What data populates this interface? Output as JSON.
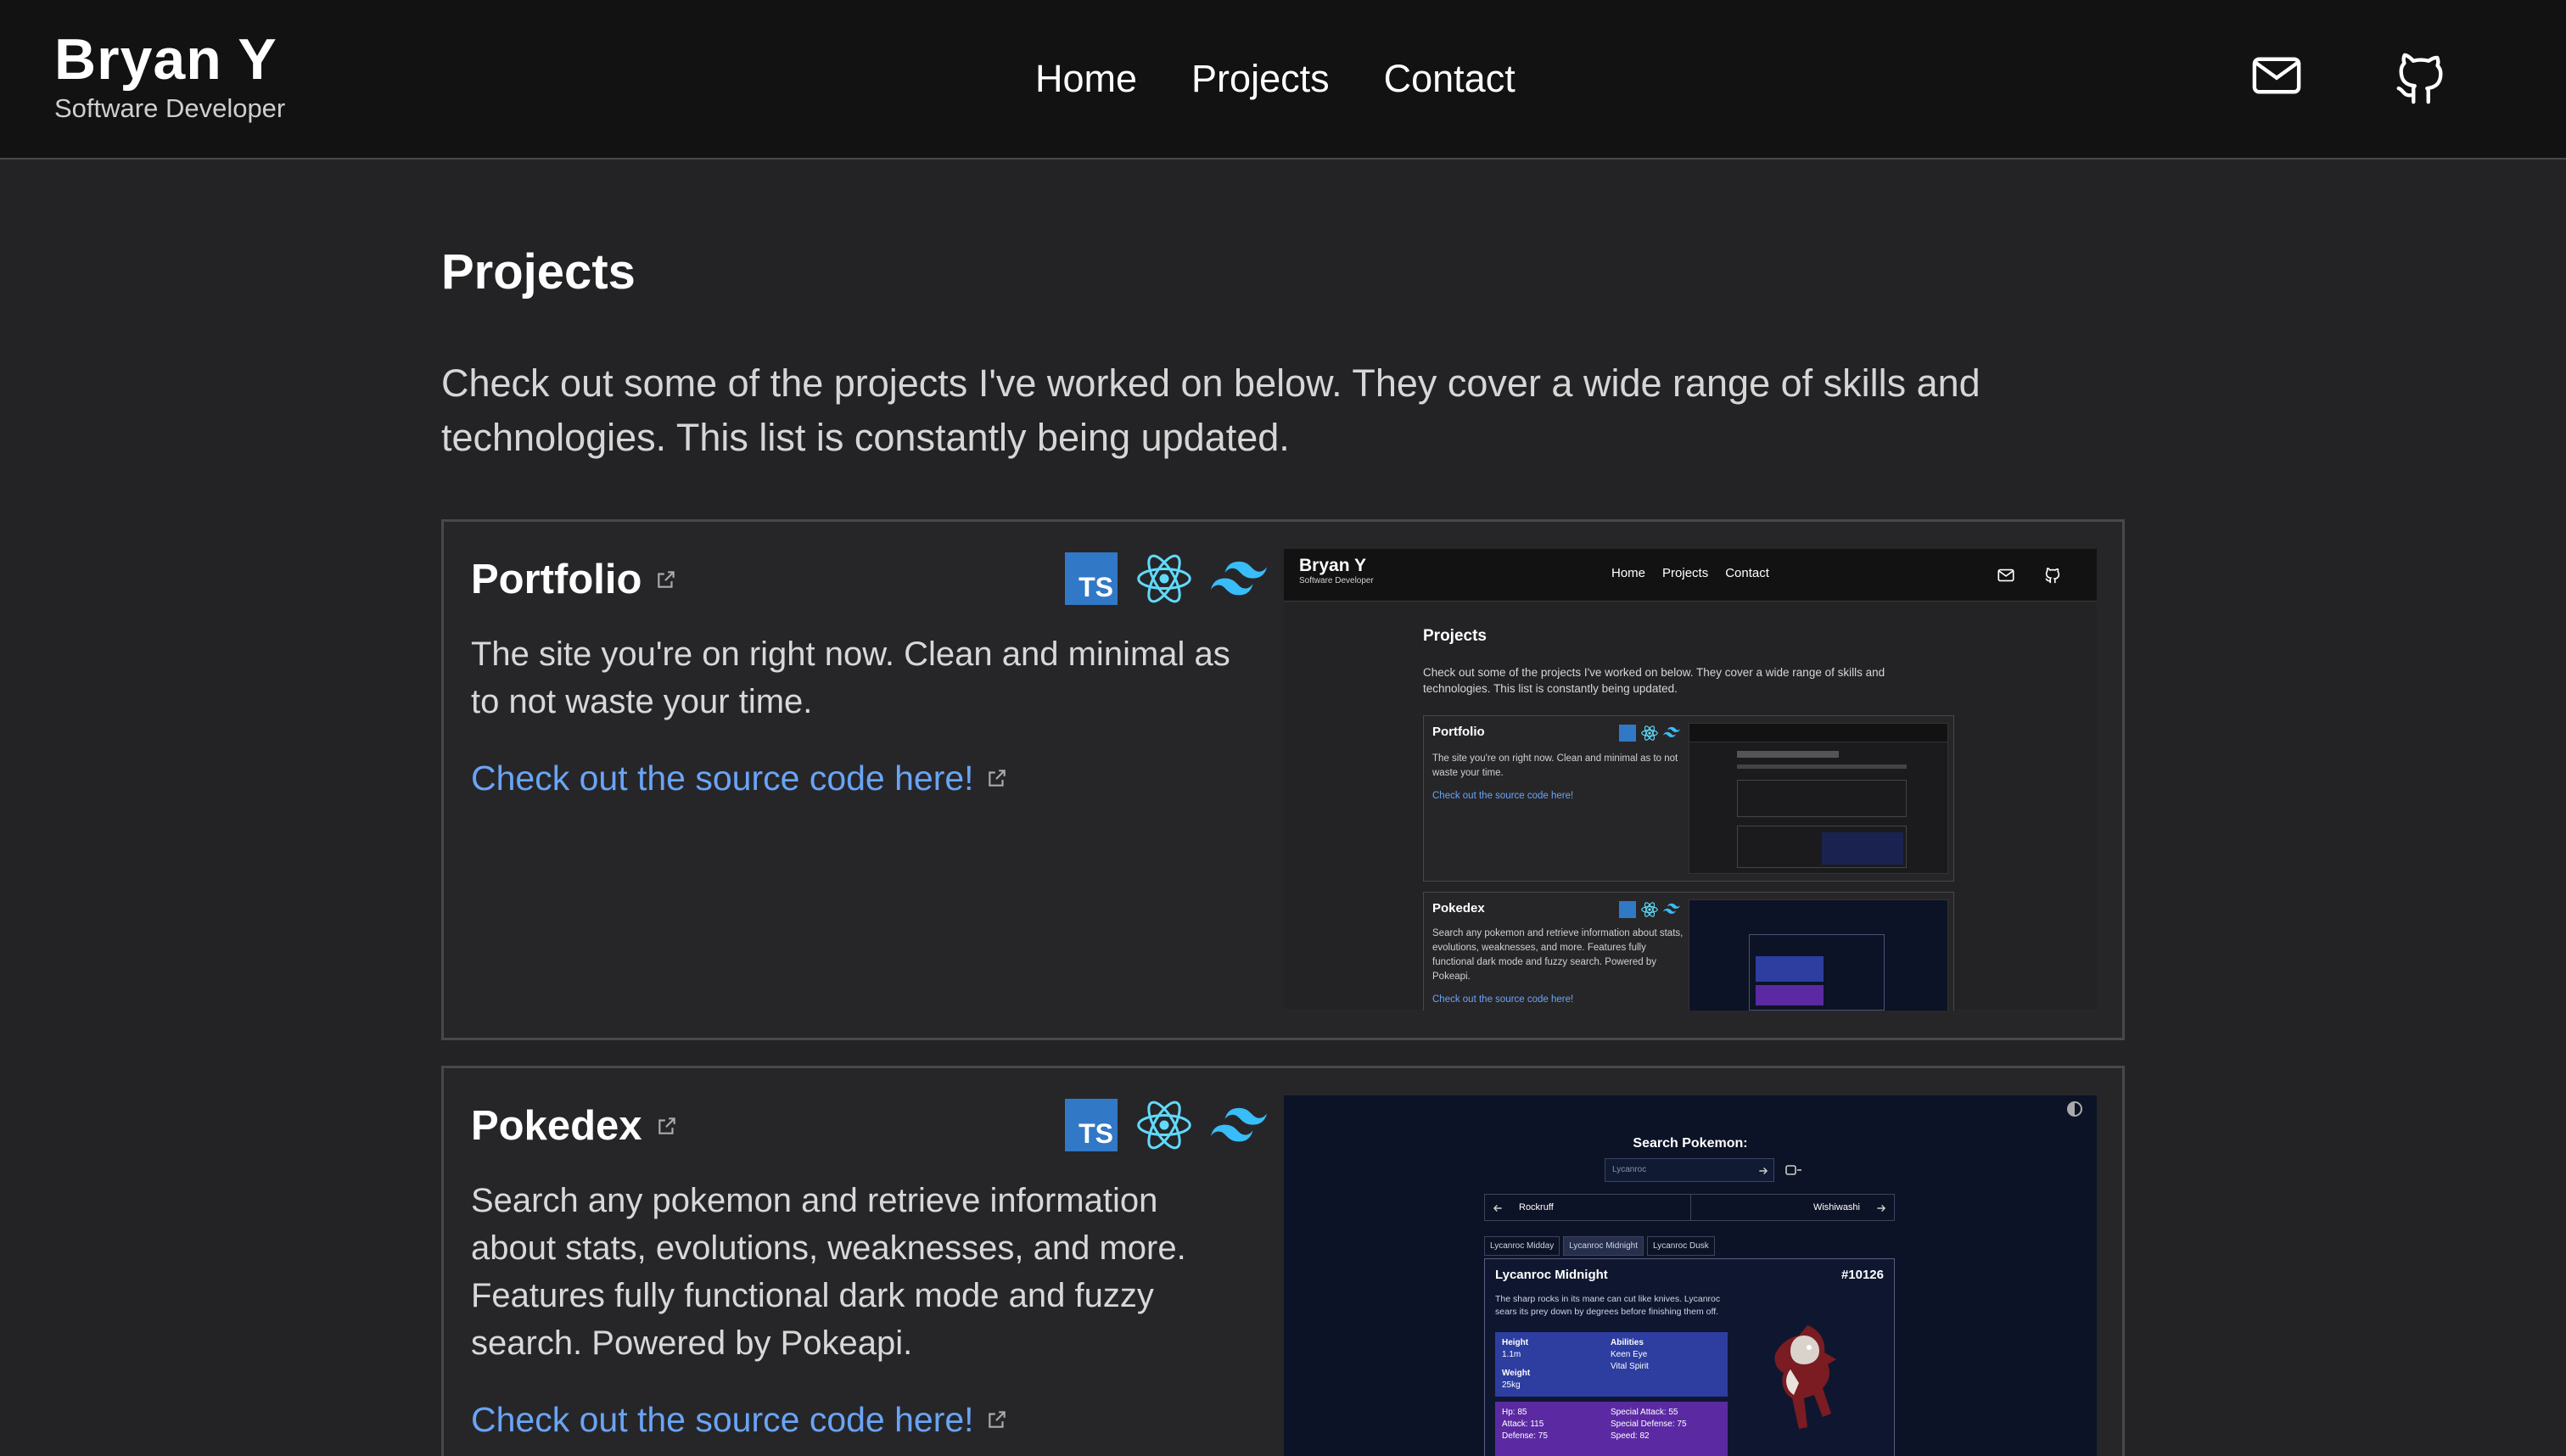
{
  "header": {
    "name": "Bryan Y",
    "role": "Software Developer",
    "nav": [
      "Home",
      "Projects",
      "Contact"
    ]
  },
  "page": {
    "title": "Projects",
    "intro": "Check out some of the projects I've worked on below. They cover a wide range of skills and technologies. This list is constantly being updated."
  },
  "projects": [
    {
      "title": "Portfolio",
      "description": "The site you're on right now. Clean and minimal as to not waste your time.",
      "link": "Check out the source code here!",
      "tech": [
        "typescript-icon",
        "react-icon",
        "tailwind-icon"
      ]
    },
    {
      "title": "Pokedex",
      "description": "Search any pokemon and retrieve information about stats, evolutions, weaknesses, and more. Features fully functional dark mode and fuzzy search. Powered by Pokeapi.",
      "link": "Check out the source code here!",
      "tech": [
        "typescript-icon",
        "react-icon",
        "tailwind-icon"
      ]
    }
  ],
  "preview_portfolio": {
    "name": "Bryan Y",
    "role": "Software Developer",
    "nav": [
      "Home",
      "Projects",
      "Contact"
    ],
    "title": "Projects",
    "intro": "Check out some of the projects I've worked on below. They cover a wide range of skills and technologies. This list is constantly being updated.",
    "card1_title": "Portfolio",
    "card1_desc": "The site you're on right now. Clean and minimal as to not waste your time.",
    "card1_link": "Check out the source code here!",
    "card2_title": "Pokedex",
    "card2_desc": "Search any pokemon and retrieve information about stats, evolutions, weaknesses, and more. Features fully functional dark mode and fuzzy search. Powered by Pokeapi.",
    "card2_link": "Check out the source code here!"
  },
  "preview_pokedex": {
    "search_title": "Search Pokemon:",
    "search_value": "Lycanroc",
    "prev": "Rockruff",
    "next": "Wishiwashi",
    "tabs": [
      "Lycanroc Midday",
      "Lycanroc Midnight",
      "Lycanroc Dusk"
    ],
    "name": "Lycanroc Midnight",
    "number": "#10126",
    "description": "The sharp rocks in its mane can cut like knives. Lycanroc sears its prey down by degrees before finishing them off.",
    "height_label": "Height",
    "height": "1.1m",
    "weight_label": "Weight",
    "weight": "25kg",
    "abilities_label": "Abilities",
    "abilities": [
      "Keen Eye",
      "Vital Spirit"
    ],
    "stats_left": [
      "Hp: 85",
      "Attack: 115",
      "Defense: 75"
    ],
    "stats_right": [
      "Special Attack: 55",
      "Special Defense: 75",
      "Speed: 82"
    ]
  },
  "colors": {
    "background": "#232325",
    "header": "#121212",
    "link": "#6aa4f5",
    "typescript": "#3178c6",
    "react": "#61dafb",
    "tailwind": "#38bdf8"
  }
}
